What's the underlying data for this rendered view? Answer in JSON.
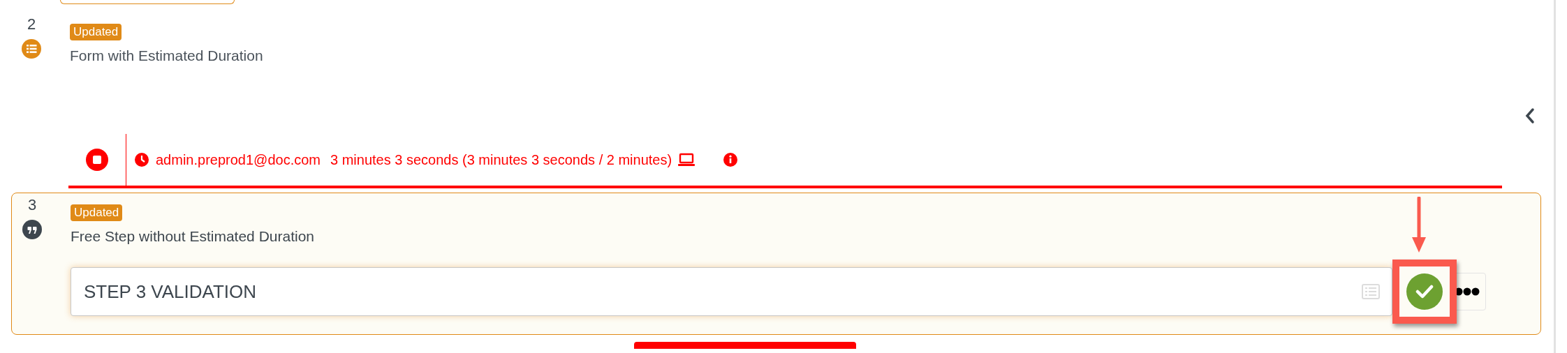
{
  "steps": [
    {
      "number": "2",
      "kind": "form",
      "badge": "Updated",
      "title": "Form with Estimated Duration",
      "active": false
    },
    {
      "number": "3",
      "kind": "free",
      "badge": "Updated",
      "title": "Free Step without Estimated Duration",
      "active": true,
      "input_value": "STEP 3 VALIDATION"
    }
  ],
  "timer": {
    "user": "admin.preprod1@doc.com",
    "duration": "3 minutes 3 seconds (3 minutes 3 seconds / 2 minutes)",
    "overdue": true
  }
}
